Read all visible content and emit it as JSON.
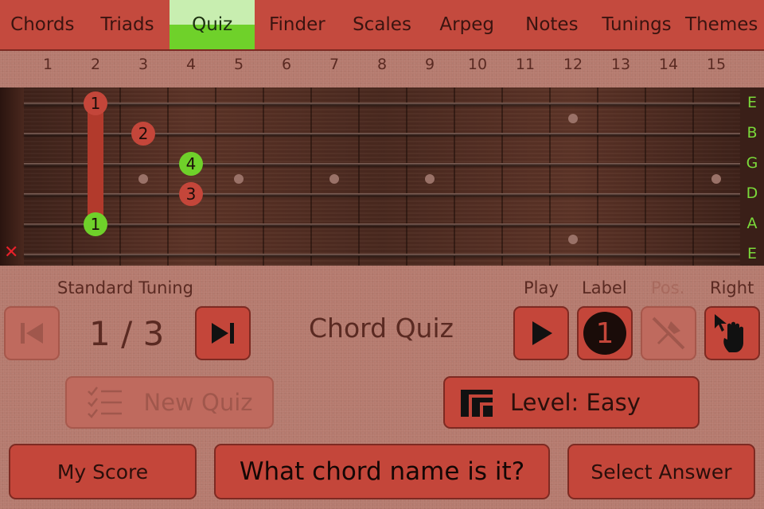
{
  "tabs": [
    {
      "id": "chords",
      "label": "Chords",
      "active": false
    },
    {
      "id": "triads",
      "label": "Triads",
      "active": false
    },
    {
      "id": "quiz",
      "label": "Quiz",
      "active": true
    },
    {
      "id": "finder",
      "label": "Finder",
      "active": false
    },
    {
      "id": "scales",
      "label": "Scales",
      "active": false
    },
    {
      "id": "arpeg",
      "label": "Arpeg",
      "active": false
    },
    {
      "id": "notes",
      "label": "Notes",
      "active": false
    },
    {
      "id": "tunings",
      "label": "Tunings",
      "active": false
    },
    {
      "id": "themes",
      "label": "Themes",
      "active": false
    }
  ],
  "fret_numbers": [
    "1",
    "2",
    "3",
    "4",
    "5",
    "6",
    "7",
    "8",
    "9",
    "10",
    "11",
    "12",
    "13",
    "14",
    "15"
  ],
  "strings": [
    "E",
    "B",
    "G",
    "D",
    "A",
    "E"
  ],
  "fingering": {
    "barre": {
      "fret": 2,
      "from_string": 1,
      "to_string": 5
    },
    "dots": [
      {
        "string": 1,
        "fret": 2,
        "finger": "1",
        "color": "red"
      },
      {
        "string": 2,
        "fret": 3,
        "finger": "2",
        "color": "red"
      },
      {
        "string": 3,
        "fret": 4,
        "finger": "4",
        "color": "green"
      },
      {
        "string": 4,
        "fret": 4,
        "finger": "3",
        "color": "red"
      },
      {
        "string": 5,
        "fret": 2,
        "finger": "1",
        "color": "green"
      }
    ],
    "muted_strings": [
      6
    ]
  },
  "inlays": [
    {
      "fret": 3,
      "between": [
        3,
        4
      ]
    },
    {
      "fret": 5,
      "between": [
        3,
        4
      ]
    },
    {
      "fret": 7,
      "between": [
        3,
        4
      ]
    },
    {
      "fret": 9,
      "between": [
        3,
        4
      ]
    },
    {
      "fret": 12,
      "between": [
        1,
        2
      ]
    },
    {
      "fret": 12,
      "between": [
        5,
        6
      ]
    },
    {
      "fret": 15,
      "between": [
        3,
        4
      ]
    }
  ],
  "icons": {
    "mute": "close-icon",
    "prev": "skip-back-icon",
    "next": "skip-forward-icon",
    "play": "play-icon",
    "pin": "pin-icon",
    "hand": "hand-pointer-icon",
    "checklist": "checklist-icon",
    "level": "level-icon"
  },
  "controls": {
    "tuning_label": "Standard Tuning",
    "counter": "1 / 3",
    "title": "Chord Quiz",
    "play_label": "Play",
    "label_label": "Label",
    "label_value": "1",
    "pos_label": "Pos.",
    "right_label": "Right",
    "new_quiz": "New Quiz",
    "level": "Level: Easy",
    "my_score": "My Score",
    "question": "What chord name is it?",
    "select_answer": "Select Answer"
  },
  "colors": {
    "accent_red": "#c4463a",
    "active_green": "#6fd12a",
    "background": "#b57a6e"
  }
}
